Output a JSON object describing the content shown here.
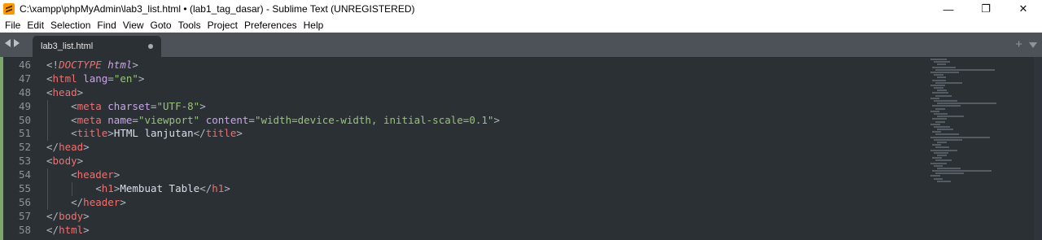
{
  "window": {
    "title": "C:\\xampp\\phpMyAdmin\\lab3_list.html • (lab1_tag_dasar) - Sublime Text (UNREGISTERED)",
    "app_icon": "sublime-text-icon",
    "controls": {
      "minimize": "—",
      "restore": "❐",
      "close": "✕"
    }
  },
  "menu": [
    "File",
    "Edit",
    "Selection",
    "Find",
    "View",
    "Goto",
    "Tools",
    "Project",
    "Preferences",
    "Help"
  ],
  "tabs": [
    {
      "label": "lab3_list.html",
      "modified": true
    }
  ],
  "tabbar": {
    "new_tab": "+"
  },
  "colors": {
    "editor_bg": "#2b3035",
    "tag": "#ef6f6f",
    "attribute": "#c9a5e8",
    "string": "#98c379",
    "punctuation": "#b0b7bf",
    "text": "#d8dee9"
  },
  "editor": {
    "line_numbers": [
      "46",
      "47",
      "48",
      "49",
      "50",
      "51",
      "52",
      "53",
      "54",
      "55",
      "56",
      "57",
      "58"
    ],
    "lines": [
      [
        [
          "punc",
          "<!"
        ],
        [
          "tag-ital",
          "DOCTYPE"
        ],
        [
          "text",
          " "
        ],
        [
          "attr-ital",
          "html"
        ],
        [
          "punc",
          ">"
        ]
      ],
      [
        [
          "punc",
          "<"
        ],
        [
          "tag",
          "html"
        ],
        [
          "text",
          " "
        ],
        [
          "attr",
          "lang"
        ],
        [
          "punc",
          "="
        ],
        [
          "str",
          "\"en\""
        ],
        [
          "punc",
          ">"
        ]
      ],
      [
        [
          "punc",
          "<"
        ],
        [
          "tag",
          "head"
        ],
        [
          "punc",
          ">"
        ]
      ],
      [
        [
          "text",
          "    "
        ],
        [
          "punc",
          "<"
        ],
        [
          "tag",
          "meta"
        ],
        [
          "text",
          " "
        ],
        [
          "attr",
          "charset"
        ],
        [
          "punc",
          "="
        ],
        [
          "str",
          "\"UTF-8\""
        ],
        [
          "punc",
          ">"
        ]
      ],
      [
        [
          "text",
          "    "
        ],
        [
          "punc",
          "<"
        ],
        [
          "tag",
          "meta"
        ],
        [
          "text",
          " "
        ],
        [
          "attr",
          "name"
        ],
        [
          "punc",
          "="
        ],
        [
          "str",
          "\"viewport\""
        ],
        [
          "text",
          " "
        ],
        [
          "attr",
          "content"
        ],
        [
          "punc",
          "="
        ],
        [
          "str",
          "\"width=device-width, initial-scale=0.1\""
        ],
        [
          "punc",
          ">"
        ]
      ],
      [
        [
          "text",
          "    "
        ],
        [
          "punc",
          "<"
        ],
        [
          "tag",
          "title"
        ],
        [
          "punc",
          ">"
        ],
        [
          "text",
          "HTML lanjutan"
        ],
        [
          "punc",
          "</"
        ],
        [
          "tag",
          "title"
        ],
        [
          "punc",
          ">"
        ]
      ],
      [
        [
          "punc",
          "</"
        ],
        [
          "tag",
          "head"
        ],
        [
          "punc",
          ">"
        ]
      ],
      [
        [
          "punc",
          "<"
        ],
        [
          "tag",
          "body"
        ],
        [
          "punc",
          ">"
        ]
      ],
      [
        [
          "text",
          "    "
        ],
        [
          "punc",
          "<"
        ],
        [
          "tag",
          "header"
        ],
        [
          "punc",
          ">"
        ]
      ],
      [
        [
          "text",
          "        "
        ],
        [
          "punc",
          "<"
        ],
        [
          "tag",
          "h1"
        ],
        [
          "punc",
          ">"
        ],
        [
          "text",
          "Membuat Table"
        ],
        [
          "punc",
          "</"
        ],
        [
          "tag",
          "h1"
        ],
        [
          "punc",
          ">"
        ]
      ],
      [
        [
          "text",
          "    "
        ],
        [
          "punc",
          "</"
        ],
        [
          "tag",
          "header"
        ],
        [
          "punc",
          ">"
        ]
      ],
      [
        [
          "punc",
          "</"
        ],
        [
          "tag",
          "body"
        ],
        [
          "punc",
          ">"
        ]
      ],
      [
        [
          "punc",
          "</"
        ],
        [
          "tag",
          "html"
        ],
        [
          "punc",
          ">"
        ]
      ]
    ]
  }
}
